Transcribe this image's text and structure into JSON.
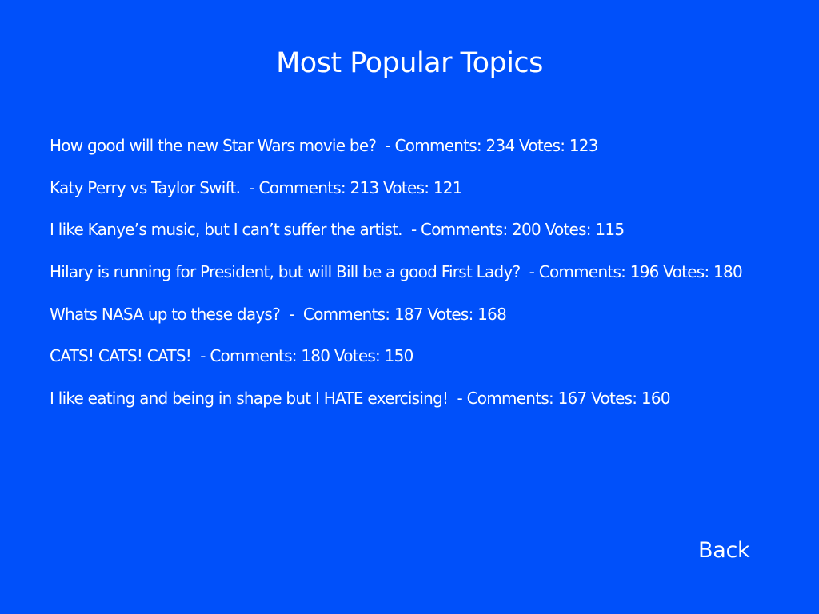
{
  "page": {
    "title": "Most Popular Topics",
    "background_color": "#0050fa",
    "text_color": "#ffffff"
  },
  "topics": [
    {
      "text": "How good will the new Star Wars movie be?  - Comments: 234 Votes: 123"
    },
    {
      "text": "Katy Perry vs Taylor Swift.  - Comments: 213 Votes: 121"
    },
    {
      "text": "I like Kanye’s music, but I can’t suffer the artist.  - Comments: 200 Votes: 115"
    },
    {
      "text": "Hilary is running for President, but will Bill be a good First Lady?  - Comments: 196 Votes: 180"
    },
    {
      "text": "Whats NASA up to these days?  -  Comments: 187 Votes: 168"
    },
    {
      "text": "CATS! CATS! CATS!  - Comments: 180 Votes: 150"
    },
    {
      "text": "I like eating and being in shape but I HATE exercising!  - Comments: 167 Votes: 160"
    }
  ],
  "back_button": {
    "label": "Back"
  }
}
